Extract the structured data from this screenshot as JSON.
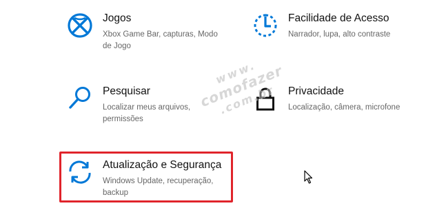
{
  "accent_color": "#0078d7",
  "highlight_color": "#e0242b",
  "tiles": {
    "jogos": {
      "icon": "xbox-icon",
      "title": "Jogos",
      "desc": "Xbox Game Bar, capturas, Modo de Jogo"
    },
    "acesso": {
      "icon": "ease-of-access-icon",
      "title": "Facilidade de Acesso",
      "desc": "Narrador, lupa, alto contraste"
    },
    "pesquisar": {
      "icon": "search-icon",
      "title": "Pesquisar",
      "desc": "Localizar meus arquivos, permissões"
    },
    "privacidade": {
      "icon": "lock-icon",
      "title": "Privacidade",
      "desc": "Localização, câmera, microfone"
    },
    "atualizacao": {
      "icon": "sync-icon",
      "title": "Atualização e Segurança",
      "desc": "Windows Update, recuperação, backup"
    }
  },
  "watermark": {
    "line1": "www.",
    "line2": "comofazer",
    "line3": ".com.br"
  }
}
